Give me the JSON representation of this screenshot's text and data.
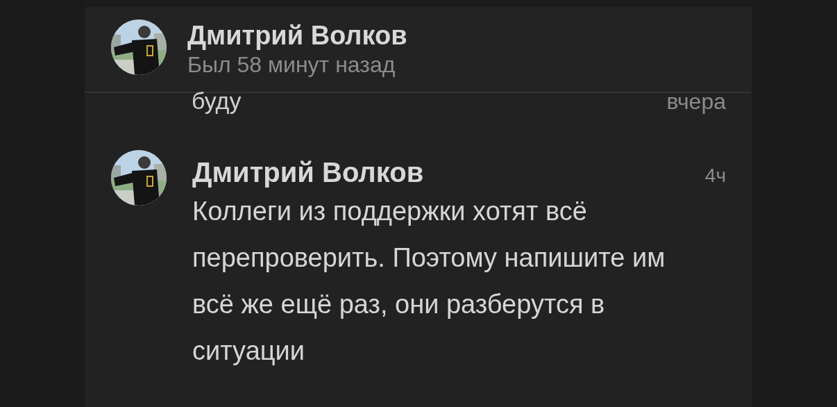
{
  "header": {
    "name": "Дмитрий Волков",
    "status": "Был 58 минут назад"
  },
  "previous_message": {
    "text": "буду",
    "time": "вчера"
  },
  "messages": [
    {
      "author": "Дмитрий Волков",
      "time": "4ч",
      "text": "Коллеги из поддержки хотят всё перепроверить. Поэтому напишите им всё же ещё раз, они разберутся в ситуации"
    }
  ]
}
